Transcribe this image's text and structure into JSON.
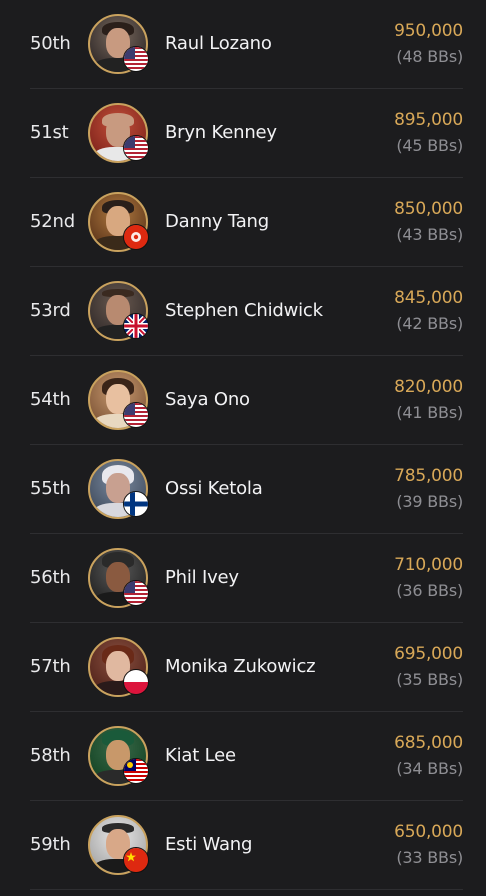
{
  "players": [
    {
      "rank": "50th",
      "name": "Raul Lozano",
      "chips": "950,000",
      "bbs": "(48 BBs)",
      "flag": "us-flag-icon"
    },
    {
      "rank": "51st",
      "name": "Bryn Kenney",
      "chips": "895,000",
      "bbs": "(45 BBs)",
      "flag": "us-flag-icon"
    },
    {
      "rank": "52nd",
      "name": "Danny Tang",
      "chips": "850,000",
      "bbs": "(43 BBs)",
      "flag": "hong-kong-flag-icon"
    },
    {
      "rank": "53rd",
      "name": "Stephen Chidwick",
      "chips": "845,000",
      "bbs": "(42 BBs)",
      "flag": "uk-flag-icon"
    },
    {
      "rank": "54th",
      "name": "Saya Ono",
      "chips": "820,000",
      "bbs": "(41 BBs)",
      "flag": "us-flag-icon"
    },
    {
      "rank": "55th",
      "name": "Ossi Ketola",
      "chips": "785,000",
      "bbs": "(39 BBs)",
      "flag": "finland-flag-icon"
    },
    {
      "rank": "56th",
      "name": "Phil Ivey",
      "chips": "710,000",
      "bbs": "(36 BBs)",
      "flag": "us-flag-icon"
    },
    {
      "rank": "57th",
      "name": "Monika Zukowicz",
      "chips": "695,000",
      "bbs": "(35 BBs)",
      "flag": "poland-flag-icon"
    },
    {
      "rank": "58th",
      "name": "Kiat Lee",
      "chips": "685,000",
      "bbs": "(34 BBs)",
      "flag": "malaysia-flag-icon"
    },
    {
      "rank": "59th",
      "name": "Esti Wang",
      "chips": "650,000",
      "bbs": "(33 BBs)",
      "flag": "china-flag-icon"
    }
  ],
  "colors": {
    "background": "#1c1c1e",
    "chips": "#d8a858",
    "bbs": "#8e8e93",
    "avatar_ring": "#c9a25e"
  }
}
